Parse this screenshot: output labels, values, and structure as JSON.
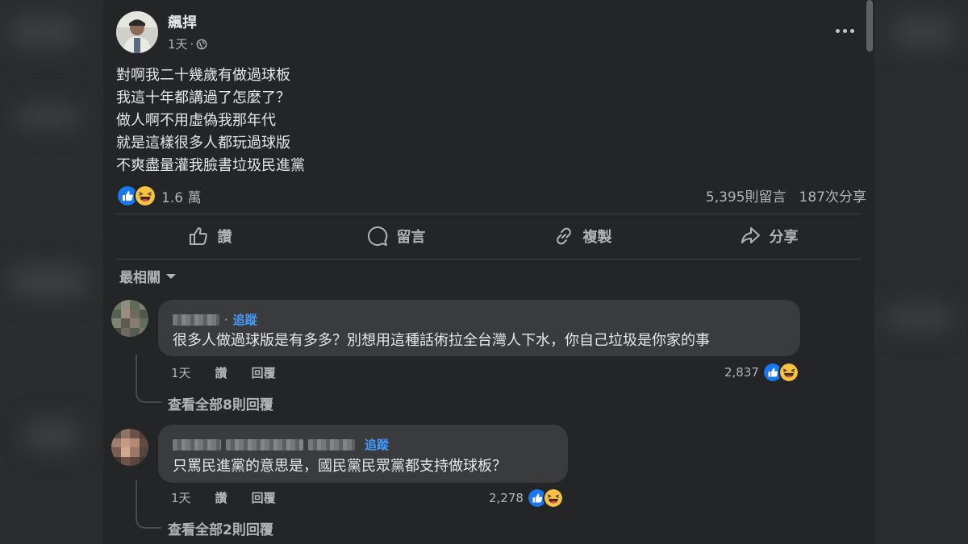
{
  "post": {
    "author": "飆捍",
    "time": "1天",
    "dot": "·",
    "lines": [
      "對啊我二十幾歲有做過球板",
      "我這十年都講過了怎麼了？",
      "做人啊不用虛偽我那年代",
      "就是這樣很多人都玩過球版",
      "不爽盡量灌我臉書垃圾民進黨"
    ],
    "reactions_count": "1.6 萬",
    "comments_count": "5,395則留言",
    "shares_count": "187次分享",
    "icons": [
      "globe-icon",
      "more-icon",
      "like-icon",
      "haha-icon"
    ]
  },
  "actions": {
    "like": "讚",
    "comment": "留言",
    "copy": "複製",
    "share": "分享"
  },
  "sort_label": "最相關",
  "comments": [
    {
      "dot": "·",
      "follow": "追蹤",
      "text": "很多人做過球版是有多多？別想用這種話術拉全台灣人下水，你自己垃圾是你家的事",
      "time": "1天",
      "like": "讚",
      "reply": "回覆",
      "reactions": "2,837",
      "view_replies": "查看全部8則回覆"
    },
    {
      "follow": "追蹤",
      "text": "只罵民進黨的意思是，國民黨民眾黨都支持做球板？",
      "time": "1天",
      "like": "讚",
      "reply": "回覆",
      "reactions": "2,278",
      "view_replies": "查看全部2則回覆"
    }
  ],
  "colors": {
    "background": "#242526",
    "bubble": "#3a3b3c",
    "text": "#e4e6eb",
    "muted": "#b0b3b8",
    "follow": "#4599ff",
    "like_blue": "#1877f2",
    "haha_yellow": "#f7c340"
  }
}
